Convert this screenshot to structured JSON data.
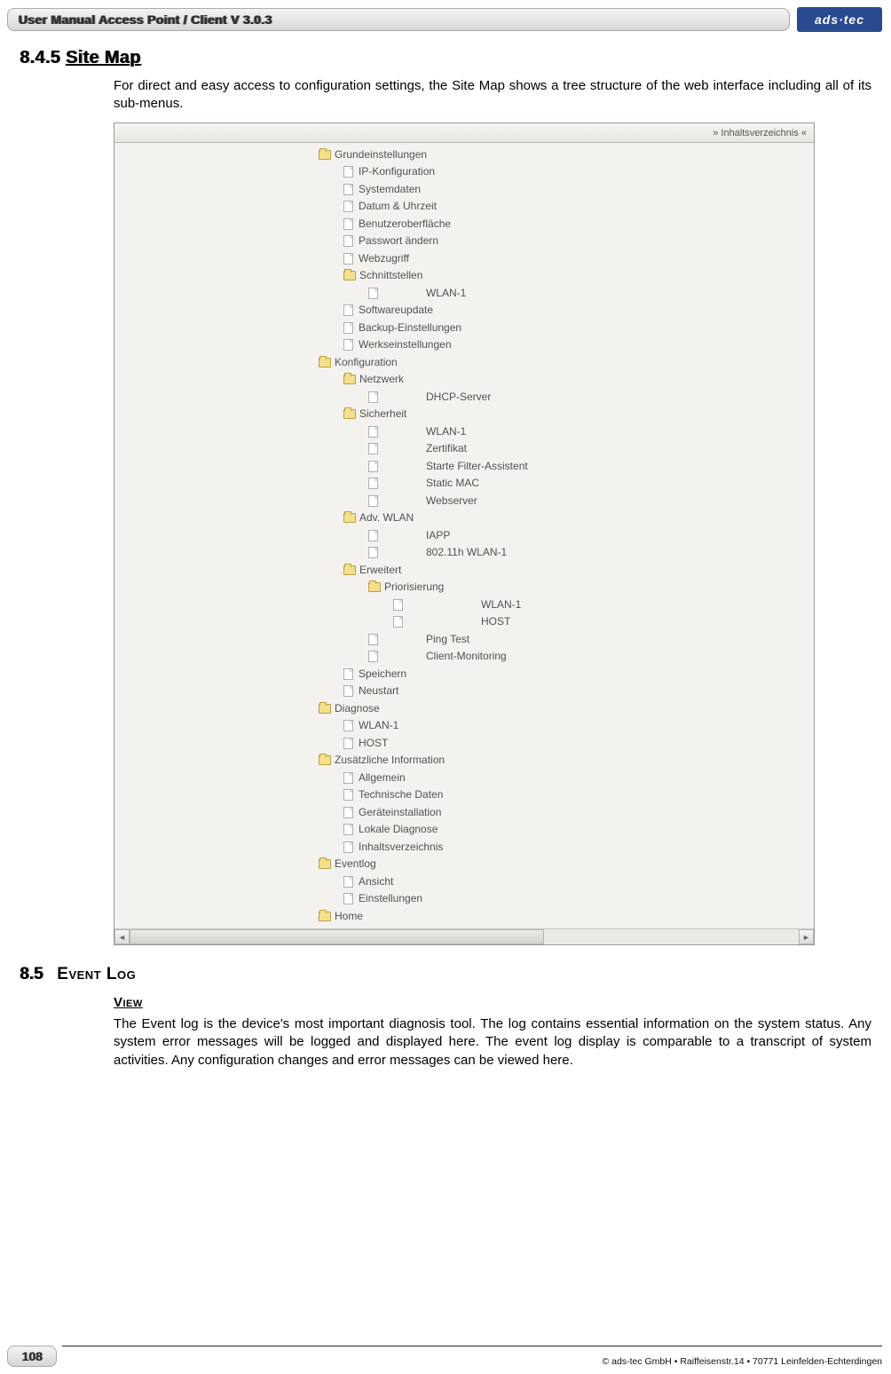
{
  "header": {
    "title": "User Manual Access Point / Client V 3.0.3",
    "logo_text": "ads·tec"
  },
  "section1": {
    "number": "8.4.5",
    "title": "Site Map",
    "body": "For direct and easy access to configuration settings, the Site Map shows a tree structure of the web interface including all of its sub-menus."
  },
  "screenshot": {
    "header_label": "» Inhaltsverzeichnis «",
    "tree": [
      {
        "type": "folder",
        "level": 1,
        "label": "Grundeinstellungen"
      },
      {
        "type": "page",
        "level": 2,
        "label": "IP-Konfiguration"
      },
      {
        "type": "page",
        "level": 2,
        "label": "Systemdaten"
      },
      {
        "type": "page",
        "level": 2,
        "label": "Datum & Uhrzeit"
      },
      {
        "type": "page",
        "level": 2,
        "label": "Benutzeroberfläche"
      },
      {
        "type": "page",
        "level": 2,
        "label": "Passwort ändern"
      },
      {
        "type": "page",
        "level": 2,
        "label": "Webzugriff"
      },
      {
        "type": "folder",
        "level": 2,
        "label": "Schnittstellen"
      },
      {
        "type": "page",
        "level": 3,
        "label": "WLAN-1",
        "wide": true
      },
      {
        "type": "page",
        "level": 2,
        "label": "Softwareupdate"
      },
      {
        "type": "page",
        "level": 2,
        "label": "Backup-Einstellungen"
      },
      {
        "type": "page",
        "level": 2,
        "label": "Werkseinstellungen"
      },
      {
        "type": "folder",
        "level": 1,
        "label": "Konfiguration"
      },
      {
        "type": "folder",
        "level": 2,
        "label": "Netzwerk"
      },
      {
        "type": "page",
        "level": 3,
        "label": "DHCP-Server",
        "wide": true
      },
      {
        "type": "folder",
        "level": 2,
        "label": "Sicherheit"
      },
      {
        "type": "page",
        "level": 3,
        "label": "WLAN-1",
        "wide": true
      },
      {
        "type": "page",
        "level": 3,
        "label": "Zertifikat",
        "wide": true
      },
      {
        "type": "page",
        "level": 3,
        "label": "Starte Filter-Assistent",
        "wide": true
      },
      {
        "type": "page",
        "level": 3,
        "label": "Static MAC",
        "wide": true
      },
      {
        "type": "page",
        "level": 3,
        "label": "Webserver",
        "wide": true
      },
      {
        "type": "folder",
        "level": 2,
        "label": "Adv. WLAN"
      },
      {
        "type": "page",
        "level": 3,
        "label": "IAPP",
        "wide": true
      },
      {
        "type": "page",
        "level": 3,
        "label": "802.11h WLAN-1",
        "wide": true
      },
      {
        "type": "folder",
        "level": 2,
        "label": "Erweitert"
      },
      {
        "type": "folder",
        "level": 3,
        "label": "Priorisierung"
      },
      {
        "type": "page",
        "level": 4,
        "label": "WLAN-1",
        "wide2": true
      },
      {
        "type": "page",
        "level": 4,
        "label": "HOST",
        "wide2": true
      },
      {
        "type": "page",
        "level": 3,
        "label": "Ping Test",
        "wide": true
      },
      {
        "type": "page",
        "level": 3,
        "label": "Client-Monitoring",
        "wide": true
      },
      {
        "type": "page",
        "level": 2,
        "label": "Speichern"
      },
      {
        "type": "page",
        "level": 2,
        "label": "Neustart"
      },
      {
        "type": "folder",
        "level": 1,
        "label": "Diagnose"
      },
      {
        "type": "page",
        "level": 2,
        "label": "WLAN-1"
      },
      {
        "type": "page",
        "level": 2,
        "label": "HOST"
      },
      {
        "type": "folder",
        "level": 1,
        "label": "Zusätzliche Information"
      },
      {
        "type": "page",
        "level": 2,
        "label": "Allgemein"
      },
      {
        "type": "page",
        "level": 2,
        "label": "Technische Daten"
      },
      {
        "type": "page",
        "level": 2,
        "label": "Geräteinstallation"
      },
      {
        "type": "page",
        "level": 2,
        "label": "Lokale Diagnose"
      },
      {
        "type": "page",
        "level": 2,
        "label": "Inhaltsverzeichnis"
      },
      {
        "type": "folder",
        "level": 1,
        "label": "Eventlog"
      },
      {
        "type": "page",
        "level": 2,
        "label": "Ansicht"
      },
      {
        "type": "page",
        "level": 2,
        "label": "Einstellungen"
      },
      {
        "type": "folder",
        "level": 1,
        "label": "Home"
      }
    ]
  },
  "section2": {
    "number": "8.5",
    "title": "Event Log",
    "sub_heading": "View",
    "body": "The Event log is the device's most important diagnosis tool. The log contains essential information on the system status. Any system error messages will be logged and displayed here. The event log display is comparable to a transcript of system activities. Any configuration changes and error messages can be viewed here."
  },
  "footer": {
    "page_number": "108",
    "copyright": "© ads-tec GmbH • Raiffeisenstr.14 • 70771 Leinfelden-Echterdingen"
  }
}
